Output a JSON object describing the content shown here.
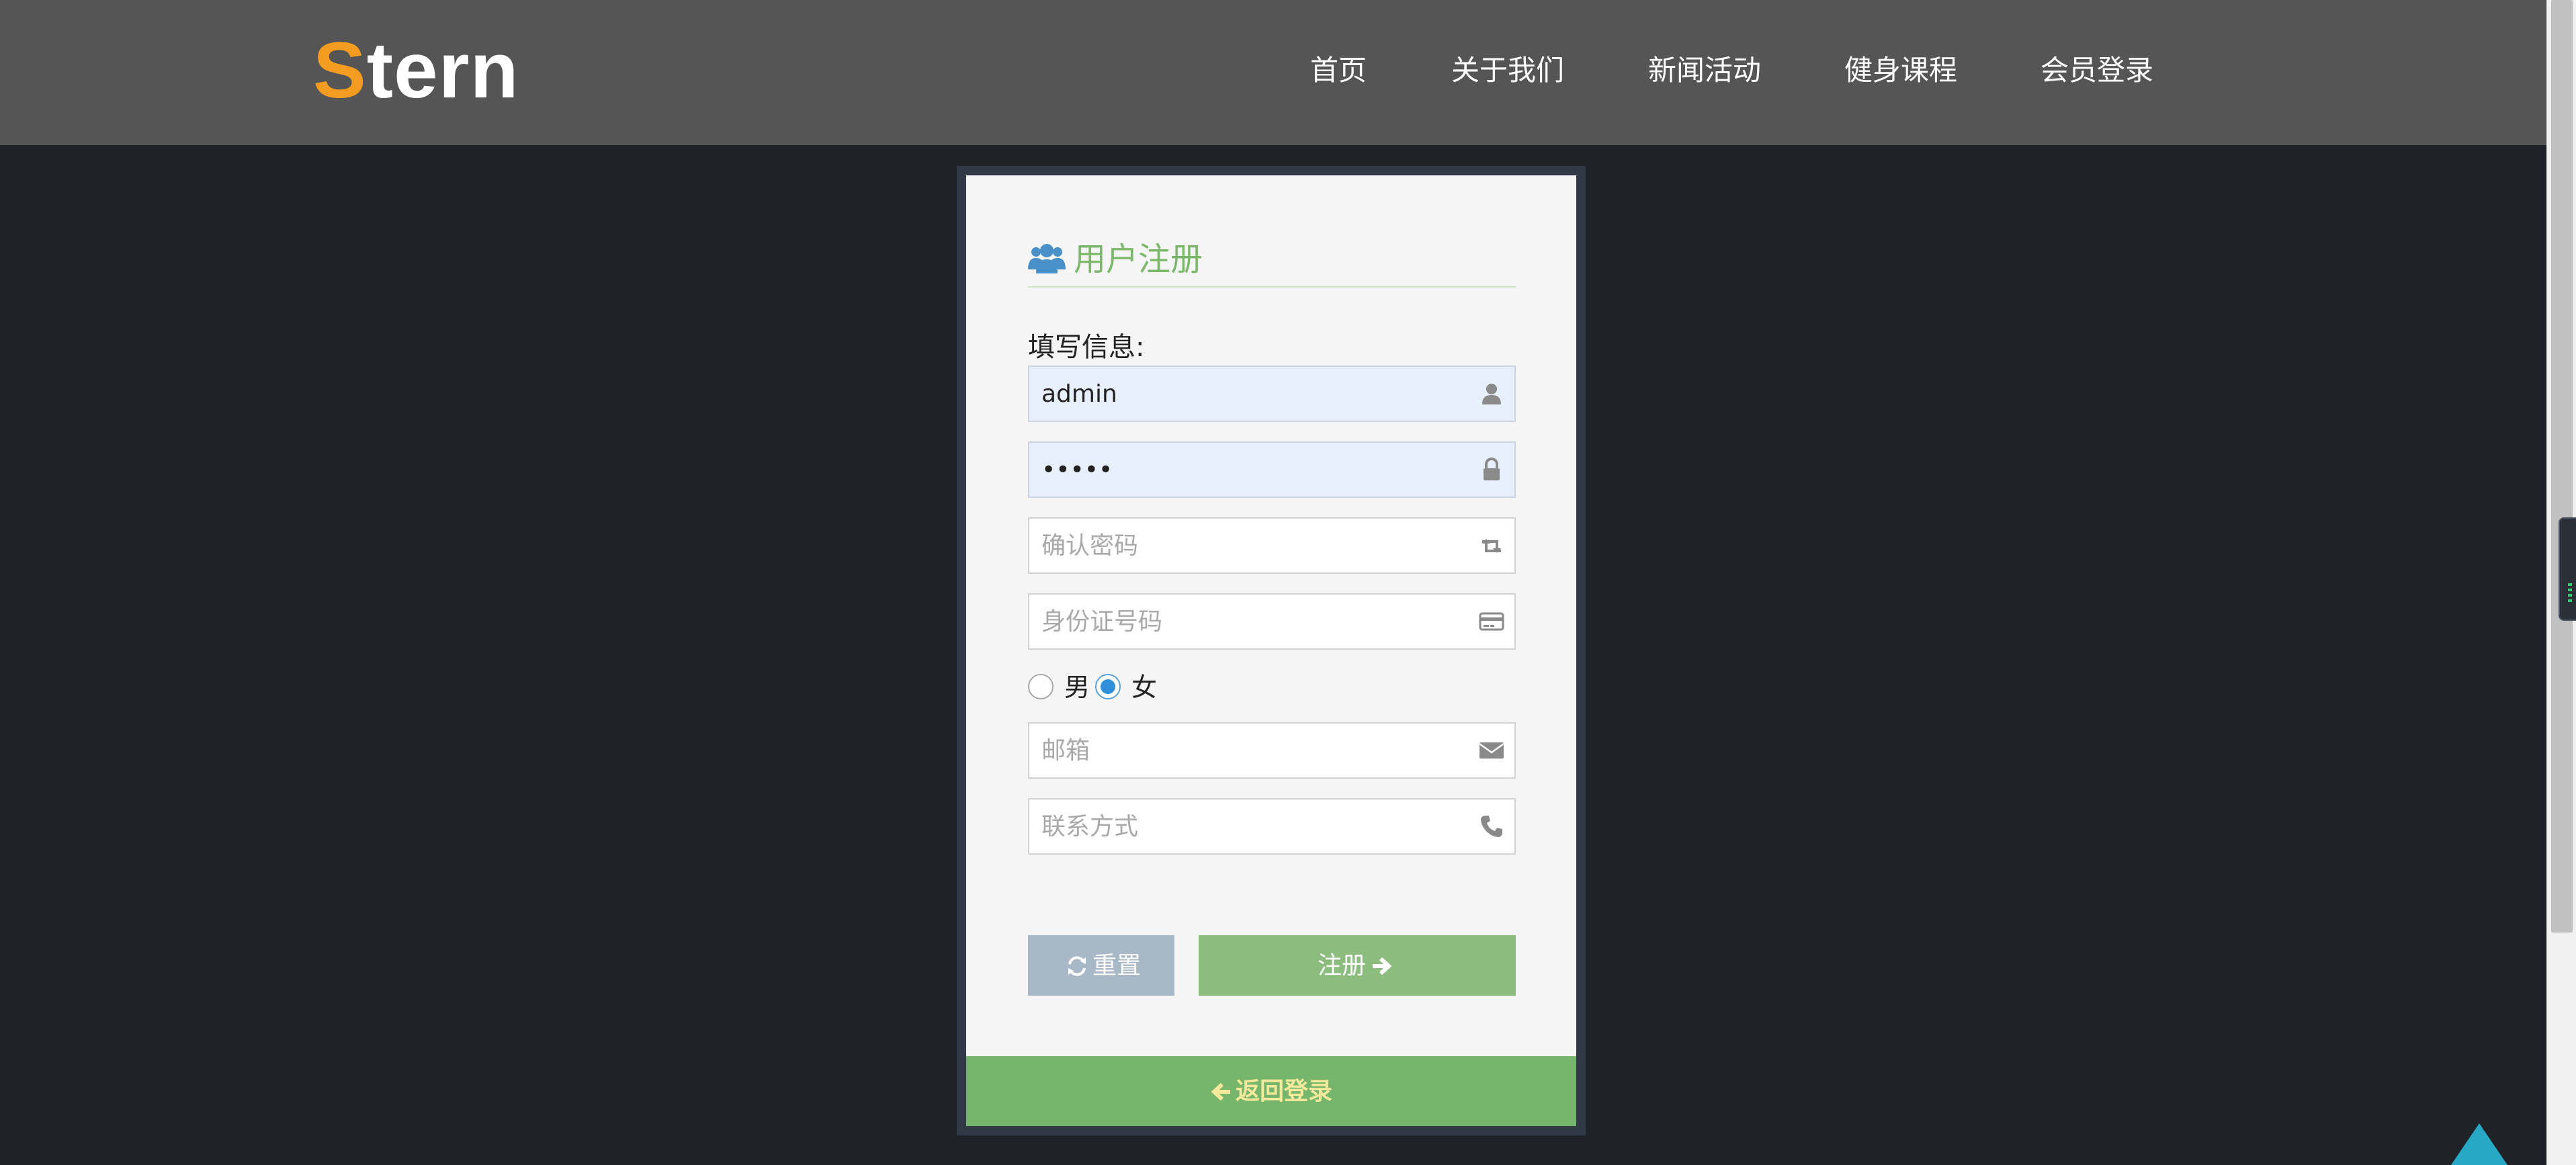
{
  "header": {
    "logo_first": "S",
    "logo_rest": "tern",
    "nav": [
      {
        "label": "首页"
      },
      {
        "label": "关于我们"
      },
      {
        "label": "新闻活动"
      },
      {
        "label": "健身课程"
      },
      {
        "label": "会员登录"
      }
    ]
  },
  "form": {
    "title": "用户注册",
    "title_icon": "users-icon",
    "section_label": "填写信息:",
    "fields": {
      "username": {
        "value": "admin",
        "placeholder": "",
        "icon": "user-icon"
      },
      "password": {
        "value": "•••••",
        "placeholder": "",
        "icon": "lock-icon"
      },
      "confirm_password": {
        "value": "",
        "placeholder": "确认密码",
        "icon": "retweet-icon"
      },
      "id_number": {
        "value": "",
        "placeholder": "身份证号码",
        "icon": "credit-card-icon"
      },
      "email": {
        "value": "",
        "placeholder": "邮箱",
        "icon": "envelope-icon"
      },
      "phone": {
        "value": "",
        "placeholder": "联系方式",
        "icon": "phone-icon"
      }
    },
    "gender": {
      "options": [
        {
          "label": "男",
          "selected": false
        },
        {
          "label": "女",
          "selected": true
        }
      ]
    },
    "reset_label": "重置",
    "submit_label": "注册",
    "back_label": "返回登录"
  },
  "colors": {
    "header_bg": "#555555",
    "page_bg": "#1f2226",
    "logo_accent": "#f39c1f",
    "title_green": "#7cb86a",
    "submit_green": "#8cbd7f",
    "back_bar_green": "#76b56c",
    "back_text": "#f5e99b",
    "reset_gray": "#a9b8c6",
    "to_top": "#27a9c6"
  }
}
